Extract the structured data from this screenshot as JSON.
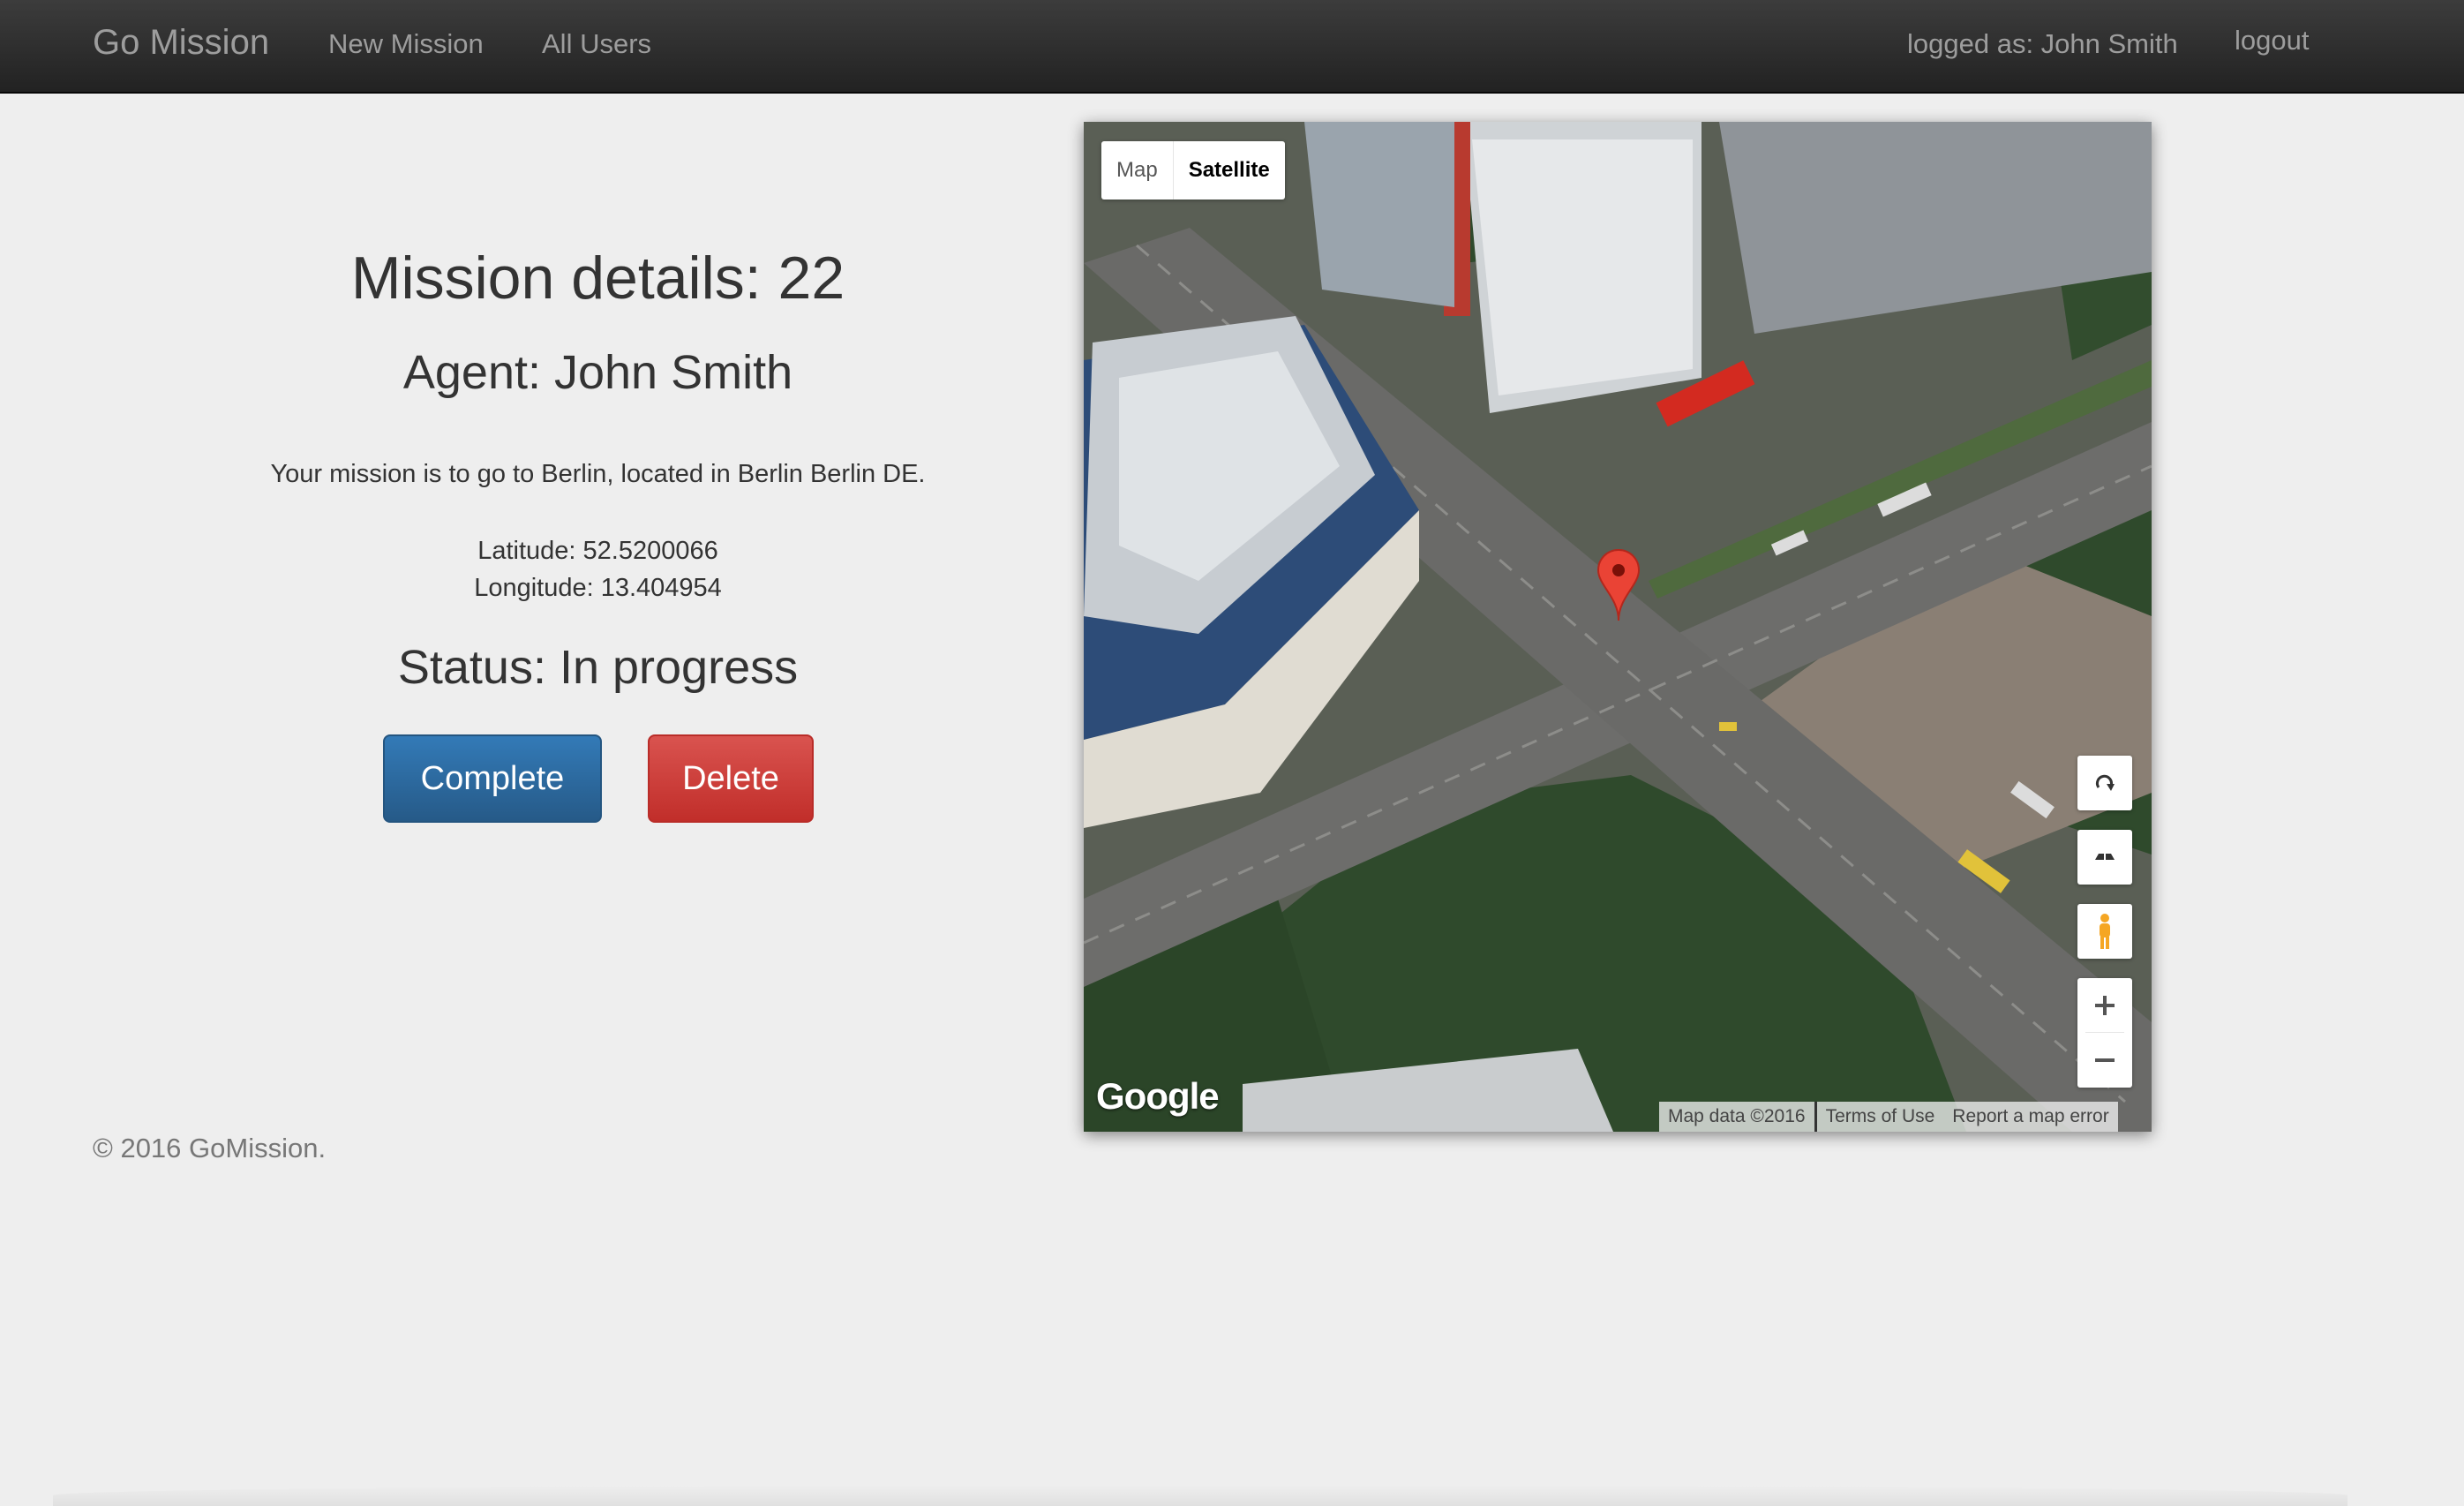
{
  "navbar": {
    "brand": "Go Mission",
    "links": [
      "New Mission",
      "All Users"
    ],
    "logged_as": "logged as: John Smith",
    "logout": "logout"
  },
  "mission": {
    "title": "Mission details: 22",
    "agent": "Agent: John Smith",
    "description": "Your mission is to go to Berlin, located in Berlin Berlin DE.",
    "latitude": "Latitude: 52.5200066",
    "longitude": "Longitude: 13.404954",
    "status": "Status: In progress"
  },
  "actions": {
    "complete": "Complete",
    "delete": "Delete"
  },
  "colors": {
    "complete": "#337ab7",
    "delete": "#d9534f",
    "navbar": "#222222"
  },
  "map": {
    "type_options": [
      "Map",
      "Satellite"
    ],
    "active_type": "Satellite",
    "logo": "Google",
    "attribution": [
      "Map data ©2016",
      "Terms of Use",
      "Report a map error"
    ],
    "icons": [
      "rotate-icon",
      "tilt-icon",
      "pegman-icon",
      "zoom-in-icon",
      "zoom-out-icon",
      "map-marker-icon"
    ]
  },
  "footer": "© 2016 GoMission."
}
